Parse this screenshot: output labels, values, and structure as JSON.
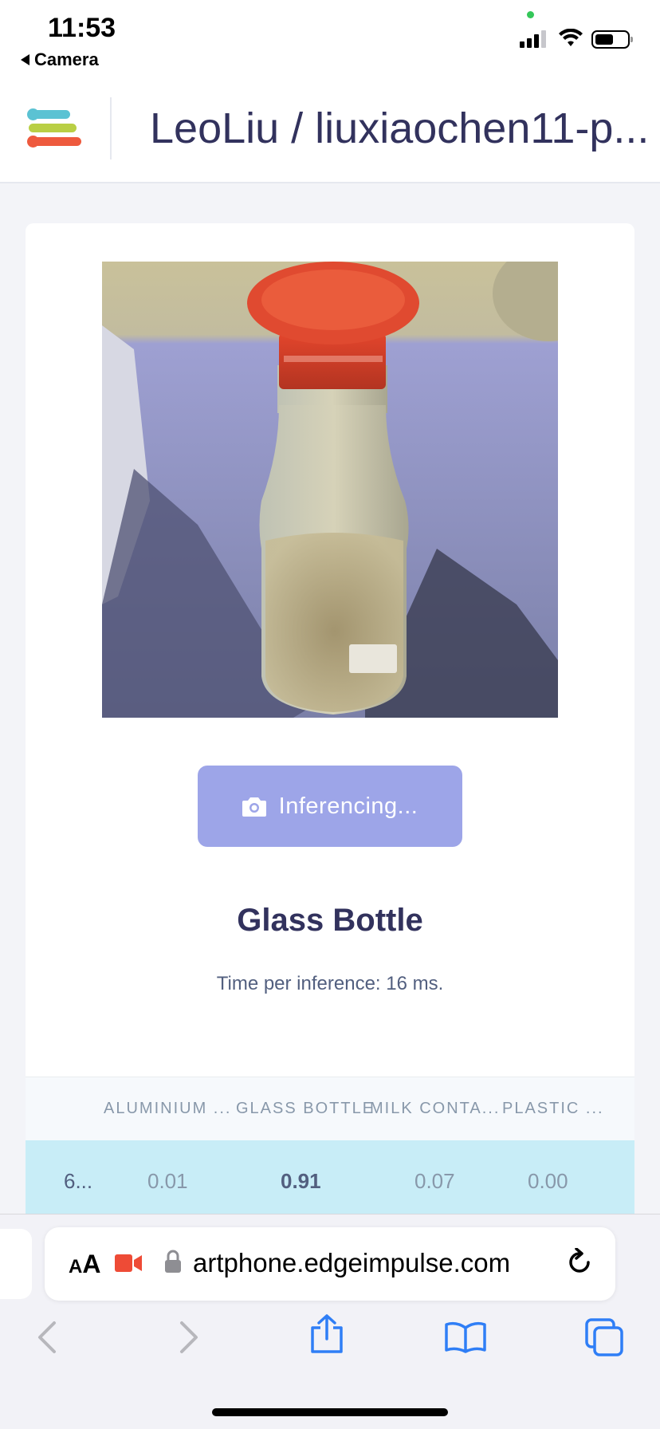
{
  "status_bar": {
    "time": "11:53",
    "back_app": "Camera"
  },
  "header": {
    "project_title": "LeoLiu / liuxiaochen11-p..."
  },
  "camera": {
    "subject": "glass bottle with red cap"
  },
  "inference": {
    "button_label": "Inferencing...",
    "result_label": "Glass Bottle",
    "time_text": "Time per inference: 16 ms."
  },
  "table": {
    "headers": [
      "ALUMINIUM ...",
      "GLASS BOTTLE",
      "MILK CONTA...",
      "PLASTIC ..."
    ],
    "row": {
      "id": "6...",
      "values": [
        "0.01",
        "0.91",
        "0.07",
        "0.00"
      ]
    }
  },
  "browser": {
    "aa_label": "AA",
    "url": "artphone.edgeimpulse.com"
  },
  "colors": {
    "accent_button": "#9da5e8",
    "row_highlight": "#c8edf7",
    "logo_teal": "#5bc2d3",
    "logo_yellow": "#b9cf45",
    "logo_red": "#ee5a3e",
    "safari_blue": "#2f7ef6"
  },
  "icons": [
    "camera-icon",
    "record-icon",
    "lock-icon",
    "reload-icon",
    "back-icon",
    "forward-icon",
    "share-icon",
    "bookmarks-icon",
    "tabs-icon"
  ]
}
